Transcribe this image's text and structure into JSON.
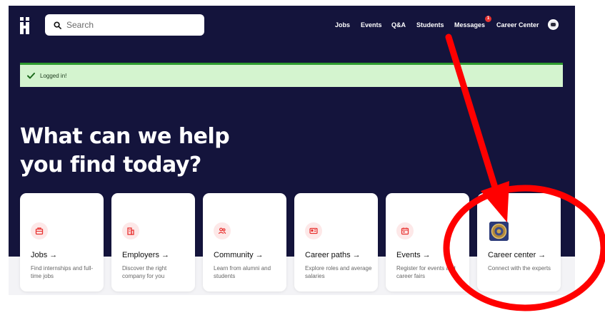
{
  "header": {
    "logo_icon": "handshake-logo",
    "search": {
      "placeholder": "Search",
      "icon": "search-icon"
    },
    "nav": [
      {
        "label": "Jobs"
      },
      {
        "label": "Events"
      },
      {
        "label": "Q&A"
      },
      {
        "label": "Students"
      },
      {
        "label": "Messages",
        "badge": "1"
      },
      {
        "label": "Career Center"
      }
    ],
    "profile_icon": "avatar"
  },
  "alert": {
    "text": "Logged in!",
    "icon": "checkmark-icon"
  },
  "hero": {
    "line1": "What can we help",
    "line2": "you find today?"
  },
  "cards": [
    {
      "title": "Jobs →",
      "desc": "Find internships and full-time jobs",
      "icon": "briefcase-icon"
    },
    {
      "title": "Employers →",
      "desc": "Discover the right company for you",
      "icon": "building-icon"
    },
    {
      "title": "Community →",
      "desc": "Learn from alumni and students",
      "icon": "people-icon"
    },
    {
      "title": "Career paths →",
      "desc": "Explore roles and average salaries",
      "icon": "id-card-icon"
    },
    {
      "title": "Events →",
      "desc": "Register for events and career fairs",
      "icon": "calendar-icon"
    },
    {
      "title": "Career center →",
      "desc": "Connect with the experts",
      "icon": "seal-icon"
    }
  ],
  "colors": {
    "background": "#14143c",
    "card": "#ffffff",
    "icon_bg": "#fde8e8",
    "icon_fg": "#e8312f",
    "alert_bg": "#d4f4cf",
    "alert_border": "#2e9b2f",
    "annotation": "#ff0000"
  }
}
